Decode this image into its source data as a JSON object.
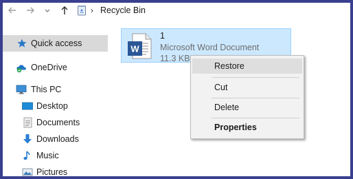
{
  "window": {
    "frame_color": "#3a3f8f"
  },
  "navbar": {
    "back_icon": "arrow-left-icon",
    "forward_icon": "arrow-right-icon",
    "dropdown_icon": "chevron-down-icon",
    "up_icon": "arrow-up-icon",
    "location_icon": "recycle-bin-icon",
    "separator": "›",
    "path": "Recycle Bin"
  },
  "sidebar": {
    "items": [
      {
        "label": "Quick access",
        "icon": "star-icon",
        "selected": true
      },
      {
        "label": "OneDrive",
        "icon": "onedrive-icon"
      },
      {
        "label": "This PC",
        "icon": "monitor-icon"
      },
      {
        "label": "Desktop",
        "icon": "desktop-folder-icon"
      },
      {
        "label": "Documents",
        "icon": "documents-icon"
      },
      {
        "label": "Downloads",
        "icon": "download-arrow-icon"
      },
      {
        "label": "Music",
        "icon": "music-note-icon"
      },
      {
        "label": "Pictures",
        "icon": "pictures-icon"
      }
    ]
  },
  "file": {
    "name": "1",
    "type": "Microsoft Word Document",
    "size": "11.3 KB",
    "icon": "word-document-icon",
    "icon_letter": "W",
    "selection_color": "#cce8ff"
  },
  "context_menu": {
    "items": [
      {
        "label": "Restore"
      },
      {
        "label": "Cut"
      },
      {
        "label": "Delete"
      },
      {
        "label": "Properties"
      }
    ]
  }
}
